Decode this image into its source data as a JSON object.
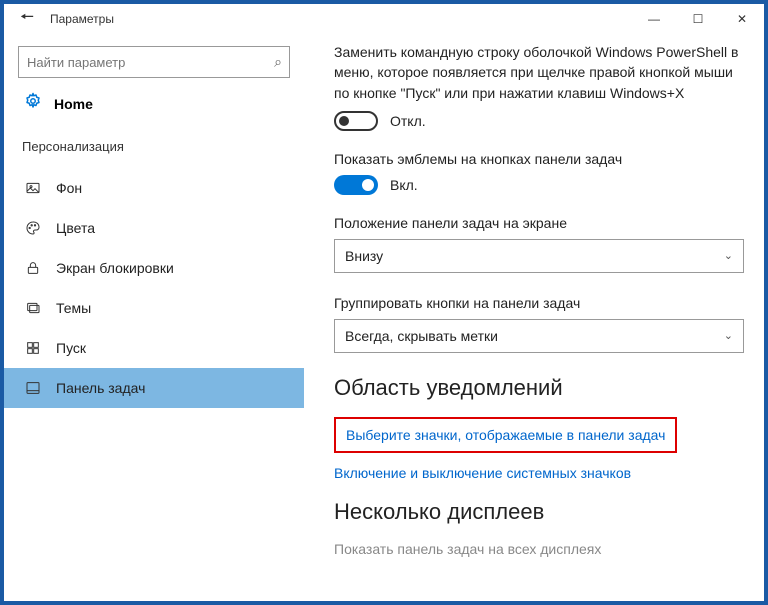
{
  "titlebar": {
    "title": "Параметры"
  },
  "sidebar": {
    "search_placeholder": "Найти параметр",
    "home_label": "Home",
    "group_label": "Персонализация",
    "items": [
      {
        "label": "Фон"
      },
      {
        "label": "Цвета"
      },
      {
        "label": "Экран блокировки"
      },
      {
        "label": "Темы"
      },
      {
        "label": "Пуск"
      },
      {
        "label": "Панель задач"
      }
    ]
  },
  "content": {
    "powershell_desc": "Заменить командную строку оболочкой Windows PowerShell в меню, которое появляется при щелчке правой кнопкой мыши по кнопке \"Пуск\" или при нажатии клавиш Windows+X",
    "off_label": "Откл.",
    "badges_label": "Показать эмблемы на кнопках панели задач",
    "on_label": "Вкл.",
    "position_label": "Положение панели задач на экране",
    "position_value": "Внизу",
    "group_label": "Группировать кнопки на панели задач",
    "group_value": "Всегда, скрывать метки",
    "notif_heading": "Область уведомлений",
    "link_select_icons": "Выберите значки, отображаемые в панели задач",
    "link_system_icons": "Включение и выключение системных значков",
    "multi_heading": "Несколько дисплеев",
    "multi_desc": "Показать панель задач на всех дисплеях"
  }
}
